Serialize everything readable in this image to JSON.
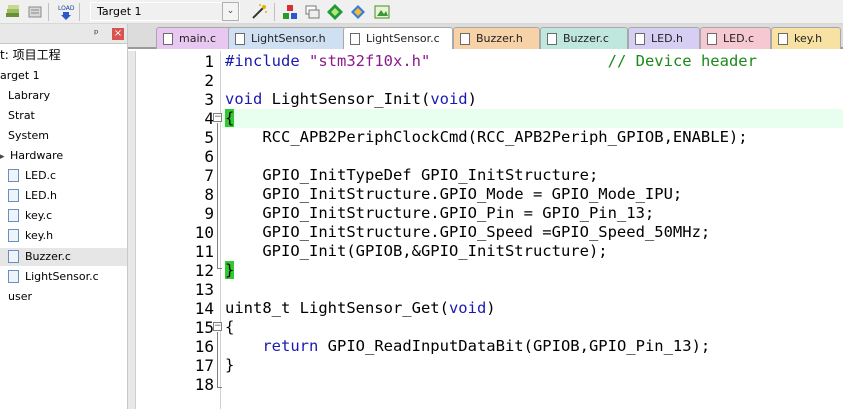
{
  "toolbar": {
    "target_value": "Target 1",
    "dropdown_glyph": "⌄"
  },
  "project": {
    "header_pin": "ᵖ",
    "close_label": "×",
    "root": "t: 项目工程",
    "target": "arget 1",
    "items": [
      {
        "label": "Labrary",
        "type": "group"
      },
      {
        "label": "Strat",
        "type": "group"
      },
      {
        "label": "System",
        "type": "group"
      },
      {
        "label": "Hardware",
        "type": "group-open"
      },
      {
        "label": "LED.c",
        "type": "file"
      },
      {
        "label": "LED.h",
        "type": "file"
      },
      {
        "label": "key.c",
        "type": "file"
      },
      {
        "label": "key.h",
        "type": "file"
      },
      {
        "label": "Buzzer.c",
        "type": "file",
        "selected": true
      },
      {
        "label": "LightSensor.c",
        "type": "file"
      },
      {
        "label": "user",
        "type": "group"
      }
    ]
  },
  "tabs": [
    {
      "label": "main.c",
      "color": "#e8c8f0"
    },
    {
      "label": "LightSensor.h",
      "color": "#cfe0f3"
    },
    {
      "label": "LightSensor.c",
      "color": "#ffffff",
      "active": true
    },
    {
      "label": "Buzzer.h",
      "color": "#f7d2a8"
    },
    {
      "label": "Buzzer.c",
      "color": "#bfe7de"
    },
    {
      "label": "LED.h",
      "color": "#d6cff3"
    },
    {
      "label": "LED.c",
      "color": "#f6c9d2"
    },
    {
      "label": "key.h",
      "color": "#f7e1a3"
    }
  ],
  "editor": {
    "line_numbers": [
      "1",
      "2",
      "3",
      "4",
      "5",
      "6",
      "7",
      "8",
      "9",
      "10",
      "11",
      "12",
      "13",
      "14",
      "15",
      "16",
      "17",
      "18"
    ],
    "code": {
      "l1_pp": "#include",
      "l1_str": "\"stm32f10x.h\"",
      "l1_cm": "// Device header",
      "l3_kw": "void",
      "l3_rest": " LightSensor_Init(",
      "l3_kw2": "void",
      "l3_end": ")",
      "l4": "{",
      "l5": "    RCC_APB2PeriphClockCmd(RCC_APB2Periph_GPIOB,ENABLE);",
      "l7": "    GPIO_InitTypeDef GPIO_InitStructure;",
      "l8": "    GPIO_InitStructure.GPIO_Mode = GPIO_Mode_IPU;",
      "l9": "    GPIO_InitStructure.GPIO_Pin = GPIO_Pin_13;",
      "l10": "    GPIO_InitStructure.GPIO_Speed =GPIO_Speed_50MHz;",
      "l11": "    GPIO_Init(GPIOB,&GPIO_InitStructure);",
      "l12": "}",
      "l14_a": "uint8_t LightSensor_Get(",
      "l14_kw": "void",
      "l14_end": ")",
      "l15": "{",
      "l16_kw": "return",
      "l16_rest": " GPIO_ReadInputDataBit(GPIOB,GPIO_Pin_13);",
      "l17": "}"
    }
  }
}
